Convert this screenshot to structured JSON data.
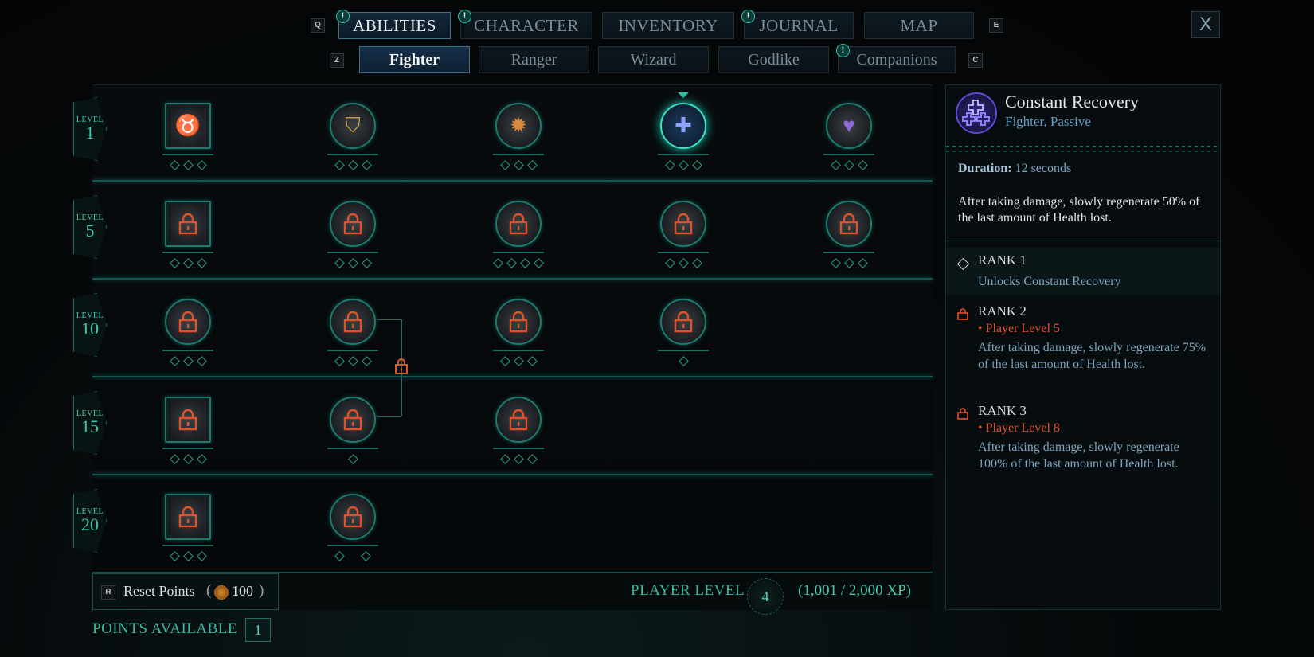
{
  "window": {
    "close_label": "X"
  },
  "main_tabs": {
    "prev_key": "Q",
    "next_key": "E",
    "items": [
      {
        "label": "ABILITIES",
        "active": true,
        "alert": "!"
      },
      {
        "label": "CHARACTER",
        "active": false,
        "alert": "!"
      },
      {
        "label": "INVENTORY",
        "active": false,
        "alert": ""
      },
      {
        "label": "JOURNAL",
        "active": false,
        "alert": "!"
      },
      {
        "label": "MAP",
        "active": false,
        "alert": ""
      }
    ]
  },
  "sub_tabs": {
    "prev_key": "Z",
    "next_key": "C",
    "items": [
      {
        "label": "Fighter",
        "active": true,
        "alert": ""
      },
      {
        "label": "Ranger",
        "active": false,
        "alert": ""
      },
      {
        "label": "Wizard",
        "active": false,
        "alert": ""
      },
      {
        "label": "Godlike",
        "active": false,
        "alert": ""
      },
      {
        "label": "Companions",
        "active": false,
        "alert": "!"
      }
    ]
  },
  "tiers": [
    {
      "level_text": "LEVEL",
      "level": "1"
    },
    {
      "level_text": "LEVEL",
      "level": "5"
    },
    {
      "level_text": "LEVEL",
      "level": "10"
    },
    {
      "level_text": "LEVEL",
      "level": "15"
    },
    {
      "level_text": "LEVEL",
      "level": "20"
    }
  ],
  "abilities": [
    {
      "tier": 0,
      "col": 0,
      "shape": "square",
      "icon": "bull-head-icon",
      "locked": false,
      "ranks": 3,
      "selected": false
    },
    {
      "tier": 0,
      "col": 1,
      "shape": "circle",
      "icon": "shield-strike-icon",
      "locked": false,
      "ranks": 3,
      "selected": false
    },
    {
      "tier": 0,
      "col": 2,
      "shape": "circle",
      "icon": "shield-burst-icon",
      "locked": false,
      "ranks": 3,
      "selected": false
    },
    {
      "tier": 0,
      "col": 3,
      "shape": "circle",
      "icon": "constant-recovery-icon",
      "locked": false,
      "ranks": 3,
      "selected": true
    },
    {
      "tier": 0,
      "col": 4,
      "shape": "circle",
      "icon": "heart-icon",
      "locked": false,
      "ranks": 3,
      "selected": false
    },
    {
      "tier": 1,
      "col": 0,
      "shape": "square",
      "icon": "lock-icon",
      "locked": true,
      "ranks": 3,
      "selected": false
    },
    {
      "tier": 1,
      "col": 1,
      "shape": "circle",
      "icon": "lock-icon",
      "locked": true,
      "ranks": 3,
      "selected": false
    },
    {
      "tier": 1,
      "col": 2,
      "shape": "circle",
      "icon": "lock-icon",
      "locked": true,
      "ranks": 4,
      "selected": false
    },
    {
      "tier": 1,
      "col": 3,
      "shape": "circle",
      "icon": "lock-icon",
      "locked": true,
      "ranks": 3,
      "selected": false
    },
    {
      "tier": 1,
      "col": 4,
      "shape": "circle",
      "icon": "lock-icon",
      "locked": true,
      "ranks": 3,
      "selected": false
    },
    {
      "tier": 2,
      "col": 0,
      "shape": "circle",
      "icon": "lock-icon",
      "locked": true,
      "ranks": 3,
      "selected": false
    },
    {
      "tier": 2,
      "col": 1,
      "shape": "circle",
      "icon": "lock-icon",
      "locked": true,
      "ranks": 3,
      "selected": false
    },
    {
      "tier": 2,
      "col": 2,
      "shape": "circle",
      "icon": "lock-icon",
      "locked": true,
      "ranks": 3,
      "selected": false
    },
    {
      "tier": 2,
      "col": 3,
      "shape": "circle",
      "icon": "lock-icon",
      "locked": true,
      "ranks": 1,
      "selected": false
    },
    {
      "tier": 3,
      "col": 0,
      "shape": "square",
      "icon": "lock-icon",
      "locked": true,
      "ranks": 3,
      "selected": false
    },
    {
      "tier": 3,
      "col": 1,
      "shape": "circle",
      "icon": "lock-icon",
      "locked": true,
      "ranks": 1,
      "selected": false
    },
    {
      "tier": 3,
      "col": 2,
      "shape": "circle",
      "icon": "lock-icon",
      "locked": true,
      "ranks": 3,
      "selected": false
    },
    {
      "tier": 4,
      "col": 0,
      "shape": "square",
      "icon": "lock-icon",
      "locked": true,
      "ranks": 3,
      "selected": false
    },
    {
      "tier": 4,
      "col": 1,
      "shape": "circle",
      "icon": "lock-icon",
      "locked": true,
      "ranks": 2,
      "selected": false
    }
  ],
  "footer": {
    "reset_key": "R",
    "reset_label": "Reset Points",
    "reset_paren_open": "(",
    "reset_cost": "100",
    "reset_paren_close": ")",
    "player_level_label": "PLAYER LEVEL",
    "player_level": "4",
    "xp": "(1,001 / 2,000 XP)",
    "points_label": "POINTS AVAILABLE",
    "points": "1"
  },
  "detail": {
    "title": "Constant Recovery",
    "subtitle": "Fighter, Passive",
    "duration_label": "Duration:",
    "duration_value": "12 seconds",
    "description": "After taking damage, slowly regenerate 50% of the last amount of Health lost.",
    "ranks": [
      {
        "title": "RANK 1",
        "requirement": "",
        "text": "Unlocks Constant Recovery",
        "unlocked": true
      },
      {
        "title": "RANK 2",
        "requirement": "• Player Level 5",
        "text": "After taking damage, slowly regenerate 75% of the last amount of Health lost.",
        "unlocked": false
      },
      {
        "title": "RANK 3",
        "requirement": "• Player Level 8",
        "text": "After taking damage, slowly regenerate 100% of the last amount of Health lost.",
        "unlocked": false
      }
    ]
  },
  "colors": {
    "accent_teal": "#2fbfa8",
    "lock_orange": "#e0522a",
    "selected_glow": "#3ce0c4",
    "subtitle_blue": "#5fa0c8"
  }
}
